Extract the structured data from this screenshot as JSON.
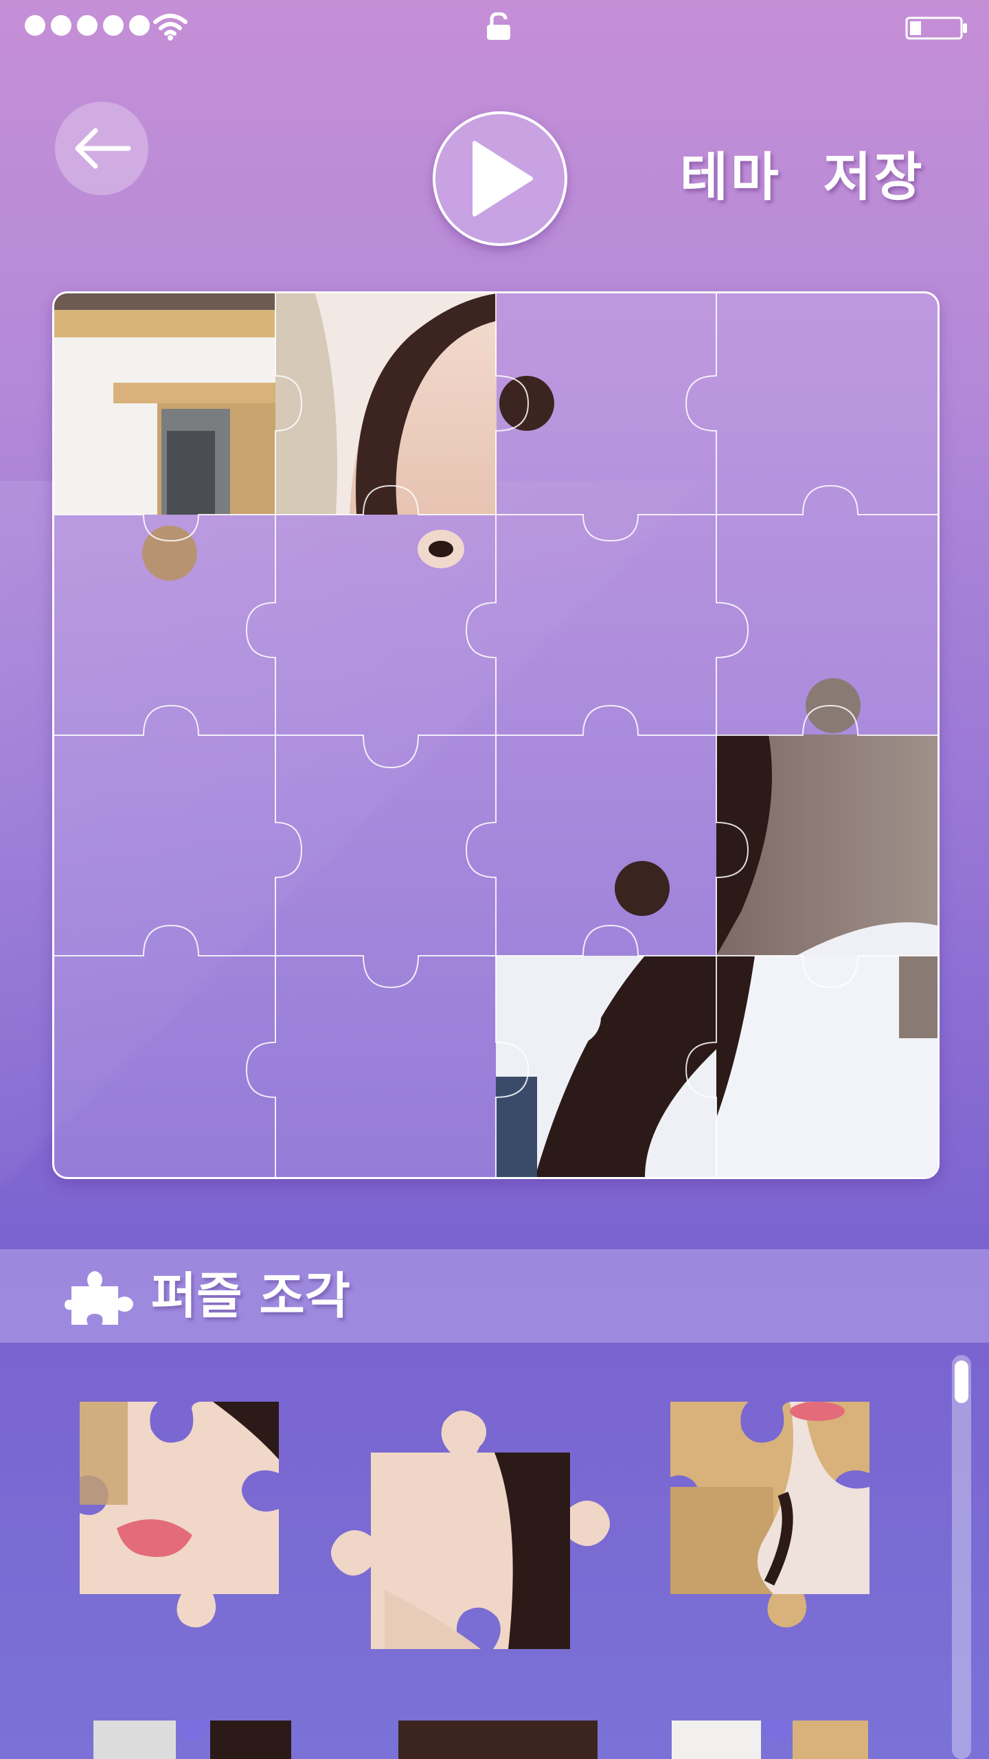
{
  "status_bar": {
    "signal_dots": 5,
    "wifi_icon": "wifi-icon",
    "lock_icon": "unlock-icon",
    "battery_icon": "battery-low-icon"
  },
  "header": {
    "back_icon": "arrow-left-icon",
    "play_icon": "play-icon",
    "save_label": "테마  저장"
  },
  "board": {
    "rows": 4,
    "cols": 4,
    "placed_pieces": 5
  },
  "pieces_section": {
    "icon": "puzzle-piece-icon",
    "title": "퍼즐 조각"
  },
  "tray": {
    "visible_pieces": 6
  },
  "colors": {
    "bg_top": "#c58fd6",
    "bg_bottom": "#7a62cf",
    "accent_white": "#ffffff"
  }
}
